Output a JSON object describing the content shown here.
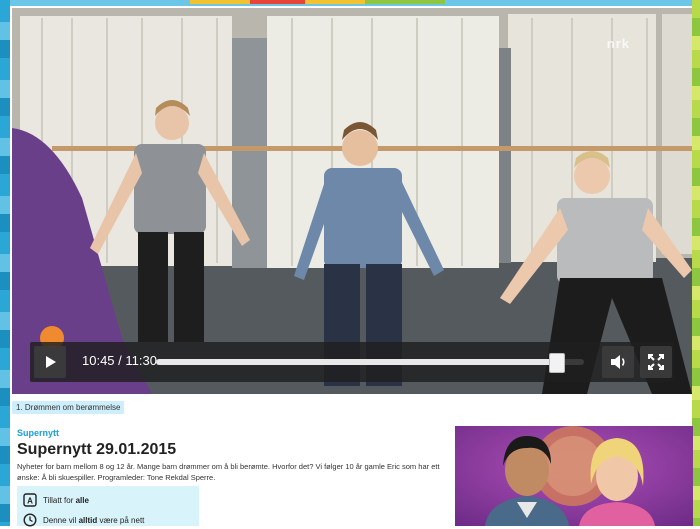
{
  "video": {
    "current_time": "10:45",
    "separator": " / ",
    "duration": "11:30",
    "progress_fraction": 0.934,
    "watermark": "nrk"
  },
  "chapter": {
    "label": "1. Drømmen om berømmelse"
  },
  "program": {
    "series": "Supernytt",
    "title": "Supernytt 29.01.2015",
    "description": "Nyheter for barn mellom 8 og 12 år. Mange barn drømmer om å bli berømte. Hvorfor det? Vi følger 10 år gamle Eric som har ett ønske: Å bli skuespiller. Programleder: Tone Rekdal Sperre."
  },
  "rating": {
    "row1_prefix": "Tillatt for ",
    "row1_bold": "alle",
    "row2_prefix": "Denne vil ",
    "row2_bold": "alltid",
    "row2_suffix": " være på nett"
  },
  "colors": {
    "accent": "#1aa0d8",
    "badge_bg": "#d9f3fb",
    "chapter_bg": "#cdeefa"
  }
}
